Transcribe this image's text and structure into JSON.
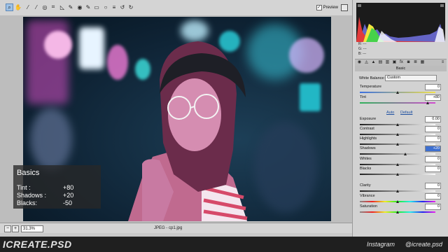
{
  "toolbar": {
    "tools": [
      "zoom-icon",
      "hand-icon",
      "white-balance-icon",
      "color-sampler-icon",
      "target-adjust-icon",
      "crop-icon",
      "straighten-icon",
      "spot-removal-icon",
      "red-eye-icon",
      "adjustment-brush-icon",
      "graduated-filter-icon",
      "radial-filter-icon",
      "preferences-icon",
      "rotate-left-icon",
      "rotate-right-icon"
    ],
    "preview_label": "Preview",
    "preview_checked": "✓"
  },
  "status": {
    "zoom": "31.3%",
    "filename": "JPEG - cp1.jpg"
  },
  "overlay": {
    "title": "Basics",
    "rows": [
      {
        "label": "Tint :",
        "value": "+80"
      },
      {
        "label": "Shadows :",
        "value": "+20"
      },
      {
        "label": "Blacks:",
        "value": "-50"
      }
    ]
  },
  "histogram": {
    "r": "R: ---",
    "g": "G: ---",
    "b": "B: ---"
  },
  "panel": {
    "section": "Basic",
    "white_balance_label": "White Balance:",
    "white_balance_value": "Custom",
    "auto": "Auto",
    "default": "Default",
    "sliders": [
      {
        "label": "Temperature",
        "value": "0",
        "pos": 0.5,
        "track": "temp"
      },
      {
        "label": "Tint",
        "value": "+80",
        "pos": 0.9,
        "track": "tint"
      },
      {
        "label": "Exposure",
        "value": "0.00",
        "pos": 0.5,
        "track": "gray"
      },
      {
        "label": "Contrast",
        "value": "0",
        "pos": 0.5,
        "track": "gray"
      },
      {
        "label": "Highlights",
        "value": "0",
        "pos": 0.5,
        "track": "gray"
      },
      {
        "label": "Shadows",
        "value": "+20",
        "pos": 0.6,
        "track": "gray",
        "selected": true
      },
      {
        "label": "Whites",
        "value": "0",
        "pos": 0.5,
        "track": "gray"
      },
      {
        "label": "Blacks",
        "value": "0",
        "pos": 0.5,
        "track": "gray"
      },
      {
        "label": "Clarity",
        "value": "0",
        "pos": 0.5,
        "track": "gray"
      },
      {
        "label": "Vibrance",
        "value": "0",
        "pos": 0.5,
        "track": "rainbow"
      },
      {
        "label": "Saturation",
        "value": "0",
        "pos": 0.5,
        "track": "rainbow"
      }
    ]
  },
  "branding": {
    "left": "ICREATE.PSD",
    "insta_label": "Instagram",
    "insta_handle": "@icreate.psd"
  },
  "colors": {
    "tint_track": "#2fb25a",
    "accent": "#3d6fd0"
  }
}
